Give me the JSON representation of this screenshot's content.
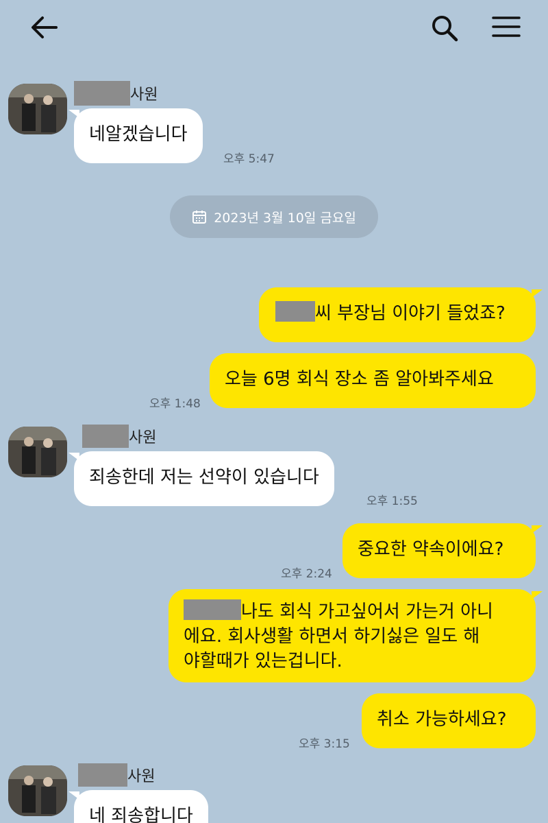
{
  "header": {
    "back_icon": "arrow-left-icon",
    "search_icon": "search-icon",
    "menu_icon": "hamburger-menu-icon"
  },
  "colors": {
    "background": "#b2c7d9",
    "my_bubble": "#fee500",
    "their_bubble": "#ffffff",
    "date_pill": "#a1b3c3"
  },
  "date_divider": {
    "icon": "calendar-icon",
    "text": "2023년 3월 10일 금요일"
  },
  "messages": [
    {
      "sender_suffix": "사원",
      "name_redacted": true,
      "text": "네알겠습니다",
      "time": "오후 5:47"
    },
    {
      "text": "씨 부장님 이야기 들었죠?",
      "name_redacted_prefix": true
    },
    {
      "text": "오늘 6명 회식 장소 좀 알아봐주세요",
      "time": "오후 1:48"
    },
    {
      "sender_suffix": "사원",
      "name_redacted": true,
      "text": "죄송한데 저는 선약이 있습니다",
      "time": "오후 1:55"
    },
    {
      "text": "중요한 약속이에요?",
      "time": "오후 2:24"
    },
    {
      "lines": [
        "나도 회식 가고싶어서 가는거 아니",
        "에요. 회사생활 하면서 하기싫은 일도 해",
        "야할때가 있는겁니다."
      ],
      "name_redacted_prefix": true
    },
    {
      "text": "취소 가능하세요?",
      "time": "오후 3:15"
    },
    {
      "sender_suffix": "사원",
      "name_redacted": true,
      "text": "네 죄송합니다"
    }
  ]
}
